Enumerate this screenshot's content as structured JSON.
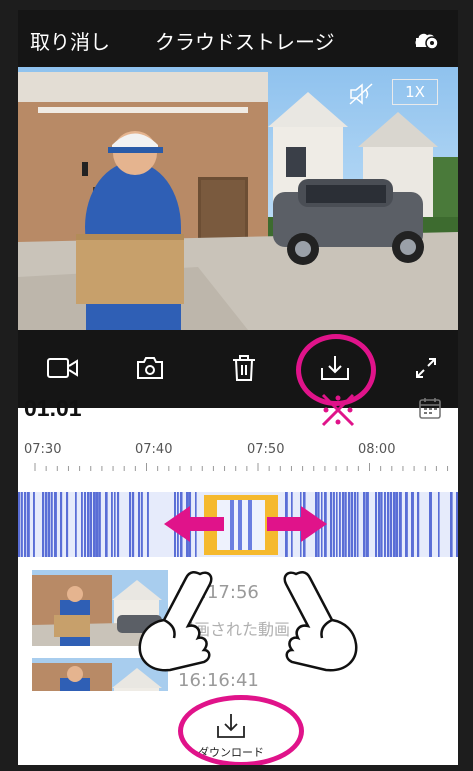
{
  "header": {
    "cancel_label": "取り消し",
    "title": "クラウドストレージ",
    "settings_icon": "cloud-settings-icon"
  },
  "video": {
    "zoom_label": "1X",
    "mute_icon": "speaker-mute-icon"
  },
  "toolbar": {
    "icons": [
      "video-record-icon",
      "camera-snapshot-icon",
      "trash-icon",
      "download-icon",
      "fullscreen-icon"
    ]
  },
  "timeline": {
    "date_label": "01.01",
    "ticks": [
      "07:30",
      "07:40",
      "07:50",
      "08:00"
    ],
    "highlight_color": "#e0138a",
    "selection_color": "#f5b92e",
    "track_color": "#5a6ed6"
  },
  "recordings": [
    {
      "time": "17:17:56",
      "caption": "録画された動画"
    },
    {
      "time": "16:16:41",
      "caption": ""
    }
  ],
  "bottom": {
    "download_label": "ダウンロード"
  },
  "annotations": {
    "accent": "#e0138a"
  }
}
